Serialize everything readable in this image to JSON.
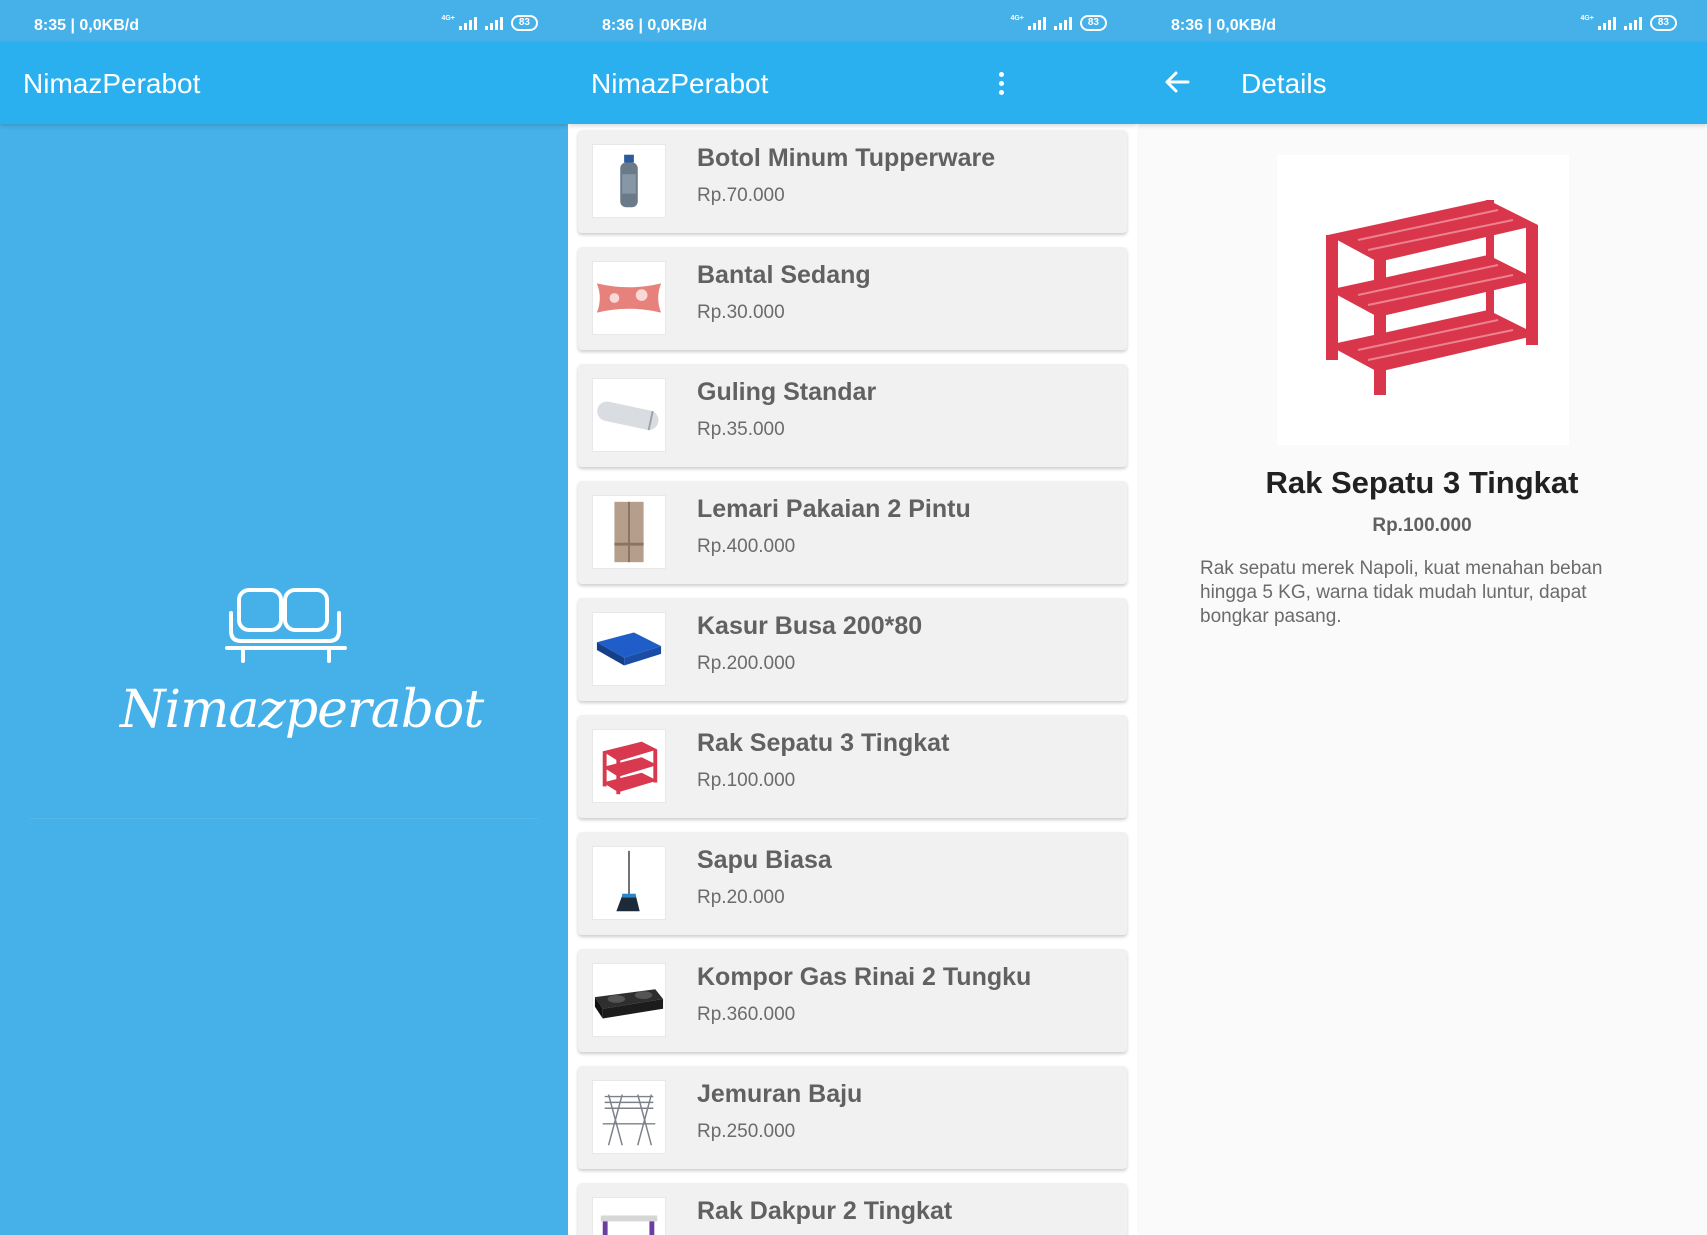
{
  "colors": {
    "primary": "#2ab0ee",
    "splash_bg": "#46b0e8",
    "card_bg": "#f1f1f1"
  },
  "splash": {
    "status": {
      "time": "8:35 | 0,0KB/d",
      "network": "4G+",
      "battery": "83"
    },
    "app_title": "NimazPerabot",
    "logo_icon": "sofa-icon"
  },
  "list": {
    "status": {
      "time": "8:36 | 0,0KB/d",
      "network": "4G+",
      "battery": "83"
    },
    "app_title": "NimazPerabot",
    "menu_icon": "overflow-menu-icon",
    "items": [
      {
        "name": "Botol Minum Tupperware",
        "price": "Rp.70.000",
        "icon": "bottle-icon"
      },
      {
        "name": "Bantal Sedang",
        "price": "Rp.30.000",
        "icon": "pillow-icon"
      },
      {
        "name": "Guling Standar",
        "price": "Rp.35.000",
        "icon": "bolster-icon"
      },
      {
        "name": "Lemari Pakaian 2 Pintu",
        "price": "Rp.400.000",
        "icon": "wardrobe-icon"
      },
      {
        "name": "Kasur Busa 200*80",
        "price": "Rp.200.000",
        "icon": "mattress-icon"
      },
      {
        "name": "Rak Sepatu 3 Tingkat",
        "price": "Rp.100.000",
        "icon": "shoe-rack-icon"
      },
      {
        "name": "Sapu Biasa",
        "price": "Rp.20.000",
        "icon": "broom-icon"
      },
      {
        "name": "Kompor Gas Rinai 2 Tungku",
        "price": "Rp.360.000",
        "icon": "gas-stove-icon"
      },
      {
        "name": "Jemuran Baju",
        "price": "Rp.250.000",
        "icon": "clothes-rack-icon"
      },
      {
        "name": "Rak Dakpur 2 Tingkat",
        "price": "",
        "icon": "kitchen-rack-icon"
      }
    ]
  },
  "detail": {
    "status": {
      "time": "8:36 | 0,0KB/d",
      "network": "4G+",
      "battery": "83"
    },
    "app_title": "Details",
    "back_icon": "back-arrow-icon",
    "name": "Rak Sepatu 3 Tingkat",
    "price": "Rp.100.000",
    "description": "Rak sepatu merek Napoli, kuat menahan beban hingga 5 KG, warna tidak mudah luntur, dapat bongkar pasang."
  }
}
